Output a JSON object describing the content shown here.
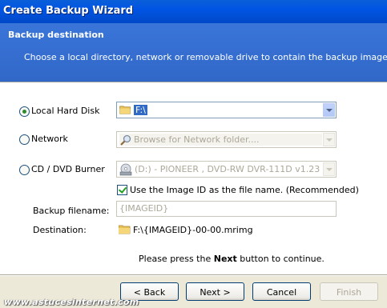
{
  "window": {
    "title": "Create Backup Wizard"
  },
  "header": {
    "title": "Backup destination",
    "subtitle": "Choose a local directory, network  or removable drive to contain the backup image."
  },
  "options": {
    "local": {
      "label": "Local Hard Disk",
      "selected": true,
      "value": "F:\\"
    },
    "network": {
      "label": "Network",
      "selected": false,
      "placeholder": "Browse for Network folder...."
    },
    "cd": {
      "label": "CD / DVD Burner",
      "selected": false,
      "value": "(D:) - PIONEER , DVD-RW  DVR-111D v1.23 (1:0"
    }
  },
  "image_id_checkbox": {
    "label": "Use the Image ID as the file name.  (Recommended)",
    "checked": true
  },
  "backup_filename": {
    "label": "Backup filename:",
    "value": "{IMAGEID}"
  },
  "destination": {
    "label": "Destination:",
    "value": "F:\\{IMAGEID}-00-00.mrimg"
  },
  "instruction": {
    "prefix": "Please press the ",
    "bold": "Next",
    "suffix": " button to continue."
  },
  "buttons": {
    "back": "< Back",
    "next": "Next >",
    "cancel": "Cancel",
    "finish": "Finish"
  },
  "watermark": "www.astucesinternet.com",
  "colors": {
    "title_bar": "#0054E3",
    "header_bg": "#3168C8",
    "dialog_bg": "#ECE9D8",
    "selection": "#316AC5"
  }
}
